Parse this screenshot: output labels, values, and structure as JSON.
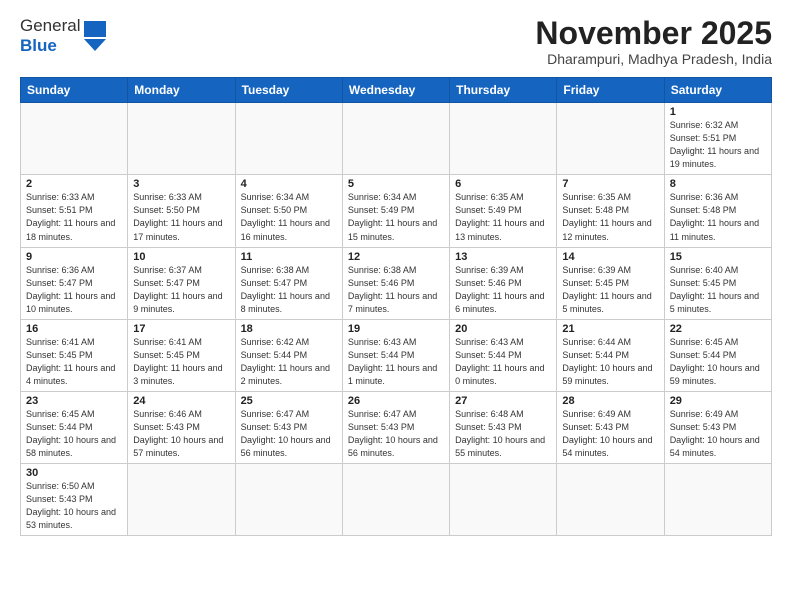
{
  "header": {
    "logo_general": "General",
    "logo_blue": "Blue",
    "month": "November 2025",
    "location": "Dharampuri, Madhya Pradesh, India"
  },
  "days_of_week": [
    "Sunday",
    "Monday",
    "Tuesday",
    "Wednesday",
    "Thursday",
    "Friday",
    "Saturday"
  ],
  "weeks": [
    [
      {
        "day": "",
        "info": ""
      },
      {
        "day": "",
        "info": ""
      },
      {
        "day": "",
        "info": ""
      },
      {
        "day": "",
        "info": ""
      },
      {
        "day": "",
        "info": ""
      },
      {
        "day": "",
        "info": ""
      },
      {
        "day": "1",
        "info": "Sunrise: 6:32 AM\nSunset: 5:51 PM\nDaylight: 11 hours and 19 minutes."
      }
    ],
    [
      {
        "day": "2",
        "info": "Sunrise: 6:33 AM\nSunset: 5:51 PM\nDaylight: 11 hours and 18 minutes."
      },
      {
        "day": "3",
        "info": "Sunrise: 6:33 AM\nSunset: 5:50 PM\nDaylight: 11 hours and 17 minutes."
      },
      {
        "day": "4",
        "info": "Sunrise: 6:34 AM\nSunset: 5:50 PM\nDaylight: 11 hours and 16 minutes."
      },
      {
        "day": "5",
        "info": "Sunrise: 6:34 AM\nSunset: 5:49 PM\nDaylight: 11 hours and 15 minutes."
      },
      {
        "day": "6",
        "info": "Sunrise: 6:35 AM\nSunset: 5:49 PM\nDaylight: 11 hours and 13 minutes."
      },
      {
        "day": "7",
        "info": "Sunrise: 6:35 AM\nSunset: 5:48 PM\nDaylight: 11 hours and 12 minutes."
      },
      {
        "day": "8",
        "info": "Sunrise: 6:36 AM\nSunset: 5:48 PM\nDaylight: 11 hours and 11 minutes."
      }
    ],
    [
      {
        "day": "9",
        "info": "Sunrise: 6:36 AM\nSunset: 5:47 PM\nDaylight: 11 hours and 10 minutes."
      },
      {
        "day": "10",
        "info": "Sunrise: 6:37 AM\nSunset: 5:47 PM\nDaylight: 11 hours and 9 minutes."
      },
      {
        "day": "11",
        "info": "Sunrise: 6:38 AM\nSunset: 5:47 PM\nDaylight: 11 hours and 8 minutes."
      },
      {
        "day": "12",
        "info": "Sunrise: 6:38 AM\nSunset: 5:46 PM\nDaylight: 11 hours and 7 minutes."
      },
      {
        "day": "13",
        "info": "Sunrise: 6:39 AM\nSunset: 5:46 PM\nDaylight: 11 hours and 6 minutes."
      },
      {
        "day": "14",
        "info": "Sunrise: 6:39 AM\nSunset: 5:45 PM\nDaylight: 11 hours and 5 minutes."
      },
      {
        "day": "15",
        "info": "Sunrise: 6:40 AM\nSunset: 5:45 PM\nDaylight: 11 hours and 5 minutes."
      }
    ],
    [
      {
        "day": "16",
        "info": "Sunrise: 6:41 AM\nSunset: 5:45 PM\nDaylight: 11 hours and 4 minutes."
      },
      {
        "day": "17",
        "info": "Sunrise: 6:41 AM\nSunset: 5:45 PM\nDaylight: 11 hours and 3 minutes."
      },
      {
        "day": "18",
        "info": "Sunrise: 6:42 AM\nSunset: 5:44 PM\nDaylight: 11 hours and 2 minutes."
      },
      {
        "day": "19",
        "info": "Sunrise: 6:43 AM\nSunset: 5:44 PM\nDaylight: 11 hours and 1 minute."
      },
      {
        "day": "20",
        "info": "Sunrise: 6:43 AM\nSunset: 5:44 PM\nDaylight: 11 hours and 0 minutes."
      },
      {
        "day": "21",
        "info": "Sunrise: 6:44 AM\nSunset: 5:44 PM\nDaylight: 10 hours and 59 minutes."
      },
      {
        "day": "22",
        "info": "Sunrise: 6:45 AM\nSunset: 5:44 PM\nDaylight: 10 hours and 59 minutes."
      }
    ],
    [
      {
        "day": "23",
        "info": "Sunrise: 6:45 AM\nSunset: 5:44 PM\nDaylight: 10 hours and 58 minutes."
      },
      {
        "day": "24",
        "info": "Sunrise: 6:46 AM\nSunset: 5:43 PM\nDaylight: 10 hours and 57 minutes."
      },
      {
        "day": "25",
        "info": "Sunrise: 6:47 AM\nSunset: 5:43 PM\nDaylight: 10 hours and 56 minutes."
      },
      {
        "day": "26",
        "info": "Sunrise: 6:47 AM\nSunset: 5:43 PM\nDaylight: 10 hours and 56 minutes."
      },
      {
        "day": "27",
        "info": "Sunrise: 6:48 AM\nSunset: 5:43 PM\nDaylight: 10 hours and 55 minutes."
      },
      {
        "day": "28",
        "info": "Sunrise: 6:49 AM\nSunset: 5:43 PM\nDaylight: 10 hours and 54 minutes."
      },
      {
        "day": "29",
        "info": "Sunrise: 6:49 AM\nSunset: 5:43 PM\nDaylight: 10 hours and 54 minutes."
      }
    ],
    [
      {
        "day": "30",
        "info": "Sunrise: 6:50 AM\nSunset: 5:43 PM\nDaylight: 10 hours and 53 minutes."
      },
      {
        "day": "",
        "info": ""
      },
      {
        "day": "",
        "info": ""
      },
      {
        "day": "",
        "info": ""
      },
      {
        "day": "",
        "info": ""
      },
      {
        "day": "",
        "info": ""
      },
      {
        "day": "",
        "info": ""
      }
    ]
  ]
}
